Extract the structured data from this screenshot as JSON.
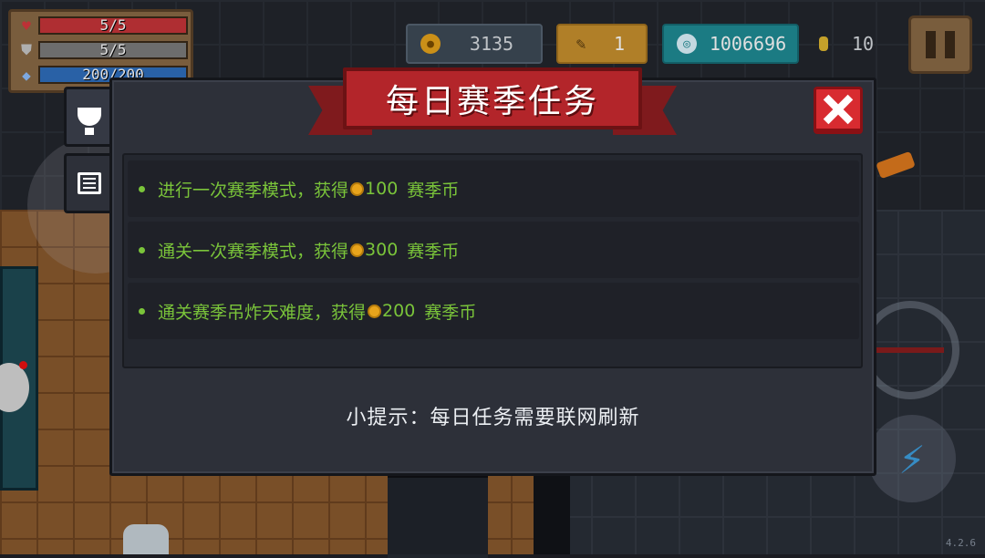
{
  "hud": {
    "hp": {
      "icon": "heart-icon",
      "text": "5/5",
      "fill": 1.0,
      "color": "#c8353a"
    },
    "armor": {
      "icon": "shield-icon",
      "text": "5/5",
      "fill": 1.0,
      "color": "#7d7d7d"
    },
    "energy": {
      "icon": "diamond-icon",
      "text": "200/200",
      "fill": 1.0,
      "color": "#2f6fbd"
    },
    "gold": "3135",
    "fish": "1",
    "gems": "1006696",
    "small_currency": "10"
  },
  "dialog": {
    "title": "每日赛季任务",
    "tasks": [
      {
        "text_before": "进行一次赛季模式，获得",
        "amount": "100",
        "unit": "赛季币"
      },
      {
        "text_before": "通关一次赛季模式，获得",
        "amount": "300",
        "unit": "赛季币"
      },
      {
        "text_before": "通关赛季吊炸天难度，获得",
        "amount": "200",
        "unit": "赛季币"
      }
    ],
    "tip": "小提示：每日任务需要联网刷新"
  },
  "version": "4.2.6",
  "colors": {
    "task_green": "#7ac43a",
    "banner_red": "#b3252a",
    "close_red": "#d82b30"
  }
}
